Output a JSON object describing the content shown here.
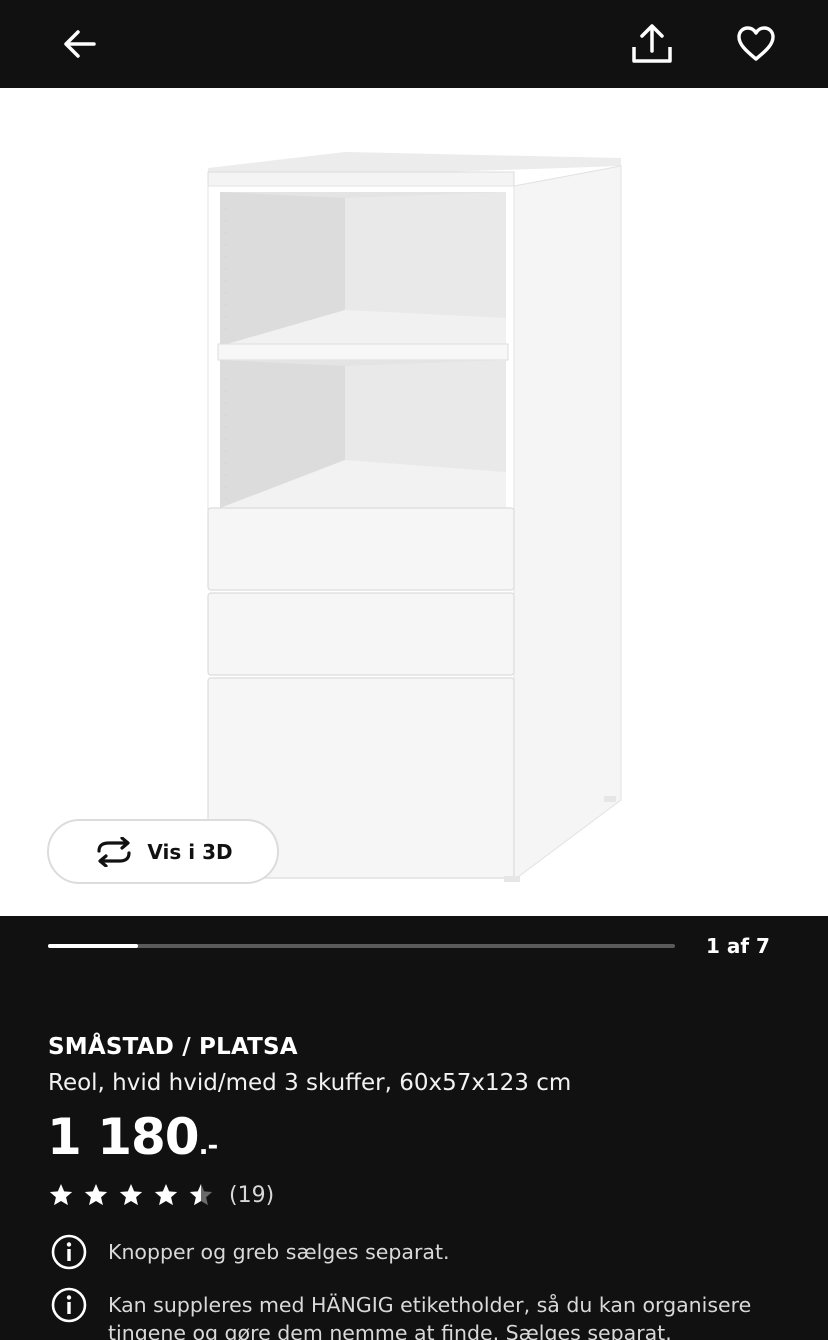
{
  "header": {
    "back_icon": "arrow-left-icon",
    "share_icon": "share-upload-icon",
    "favorite_icon": "heart-outline-icon"
  },
  "gallery": {
    "view_3d_label": "Vis i 3D",
    "view_3d_icon": "rotate-arrows-icon",
    "page_indicator": "1 af 7",
    "progress_fraction": 0.143
  },
  "product": {
    "name": "SMÅSTAD / PLATSA",
    "description": "Reol, hvid hvid/med 3 skuffer, 60x57x123 cm",
    "price": "1 180",
    "price_suffix": ".-",
    "rating": 4.5,
    "rating_max": 5,
    "review_count": "(19)"
  },
  "notes": [
    {
      "icon": "info-icon",
      "text": "Knopper og greb sælges separat."
    },
    {
      "icon": "info-icon",
      "text": "Kan suppleres med HÄNGIG etiketholder, så du kan organisere tingene og gøre dem nemme at finde. Sælges separat."
    }
  ],
  "colors": {
    "background": "#111111",
    "text": "#ffffff",
    "muted_text": "#d9d9d9",
    "progress_track": "#5a5a5a",
    "star": "#ffffff"
  }
}
